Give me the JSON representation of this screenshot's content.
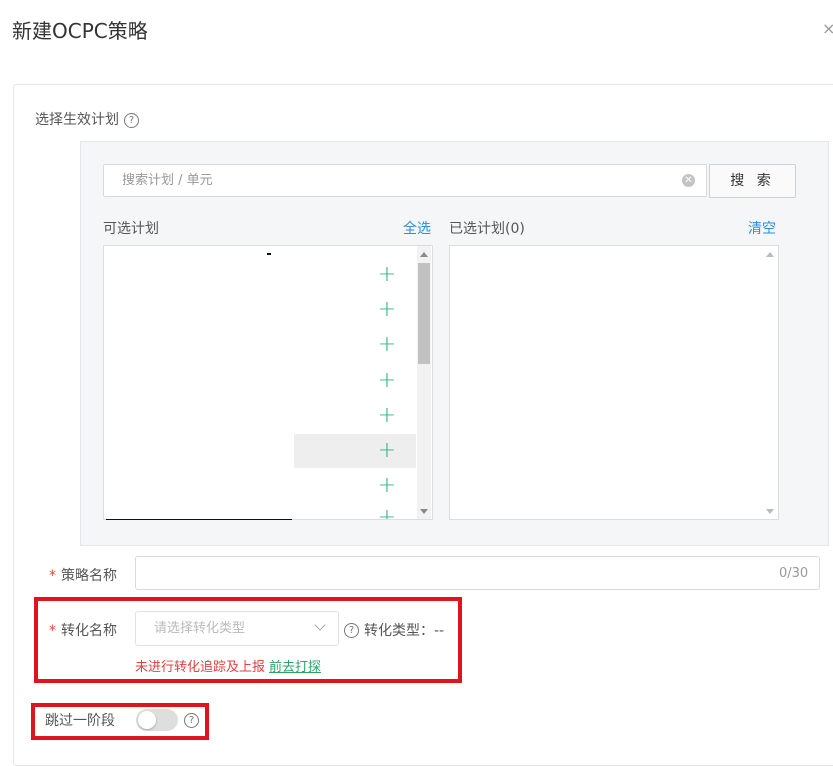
{
  "dialog": {
    "title": "新建OCPC策略",
    "close_symbol": "×"
  },
  "plan_selector": {
    "label": "选择生效计划",
    "help_symbol": "?",
    "search": {
      "placeholder": "搜索计划 / 单元",
      "button_label": "搜 索"
    },
    "available": {
      "header": "可选计划",
      "select_all_label": "全选",
      "add_symbol": "+",
      "item_count_visible": 7
    },
    "selected": {
      "header": "已选计划(0)",
      "clear_label": "清空"
    }
  },
  "form": {
    "required_mark": "*",
    "strategy_name": {
      "label": "策略名称",
      "value": "",
      "counter": "0/30"
    },
    "conversion_name": {
      "label": "转化名称",
      "placeholder": "请选择转化类型",
      "conversion_type_label": "转化类型：--",
      "warning_text": "未进行转化追踪及上报",
      "warning_link": "前去打探"
    },
    "skip_stage": {
      "label": "跳过一阶段",
      "enabled": false
    }
  },
  "colors": {
    "accent_link": "#2b8fd8",
    "add_green": "#2fb37f",
    "error_red": "#e0413e",
    "highlight_red": "#e0141e"
  }
}
